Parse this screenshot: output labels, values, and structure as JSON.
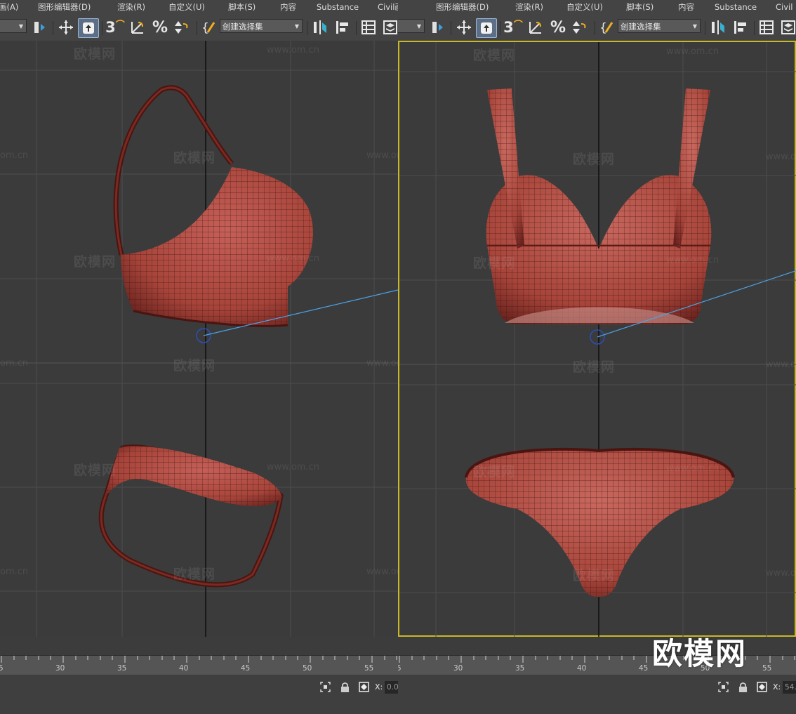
{
  "menu": [
    "画(A)",
    "图形编辑器(D)",
    "渲染(R)",
    "自定义(U)",
    "脚本(S)",
    "内容",
    "Substance",
    "Civil画(A)",
    "图形编辑器(D)",
    "渲染(R)",
    "自定义(U)",
    "脚本(S)",
    "内容",
    "Substance",
    "Civil"
  ],
  "toolbar": {
    "selection_set_placeholder": "创建选择集",
    "snap_3_label": "3",
    "percent_label": "%",
    "icons": [
      "select-move-icon",
      "select-object-icon",
      "snap-toggle-icon",
      "angle-snap-icon",
      "percent-snap-icon",
      "spinner-snap-icon",
      "named-selection-icon",
      "mirror-icon",
      "align-icon",
      "scene-explorer-icon",
      "layer-explorer-icon"
    ]
  },
  "viewports": {
    "left": {
      "name": "bikini-model-side-view",
      "active": false
    },
    "right": {
      "name": "bikini-model-front-view",
      "active": true
    }
  },
  "timeline": {
    "left_ticks": [
      "5",
      "30",
      "35",
      "40",
      "45",
      "50",
      "55"
    ],
    "right_ticks": [
      "5",
      "30",
      "35",
      "40",
      "45",
      "50",
      "55"
    ]
  },
  "status": {
    "left_x_label": "X:",
    "left_x_value": "0.0",
    "right_x_label": "X:",
    "right_x_value": "54."
  },
  "watermarks": {
    "cn": "欧模网",
    "url": "www.om.cn",
    "url_short": "om.cn"
  },
  "brand_logo": "欧模网",
  "colors": {
    "mesh": "#b24a40",
    "mesh_dark": "#5e1a15",
    "active_border": "#c8b827",
    "axis_line": "#4aa3e8"
  }
}
